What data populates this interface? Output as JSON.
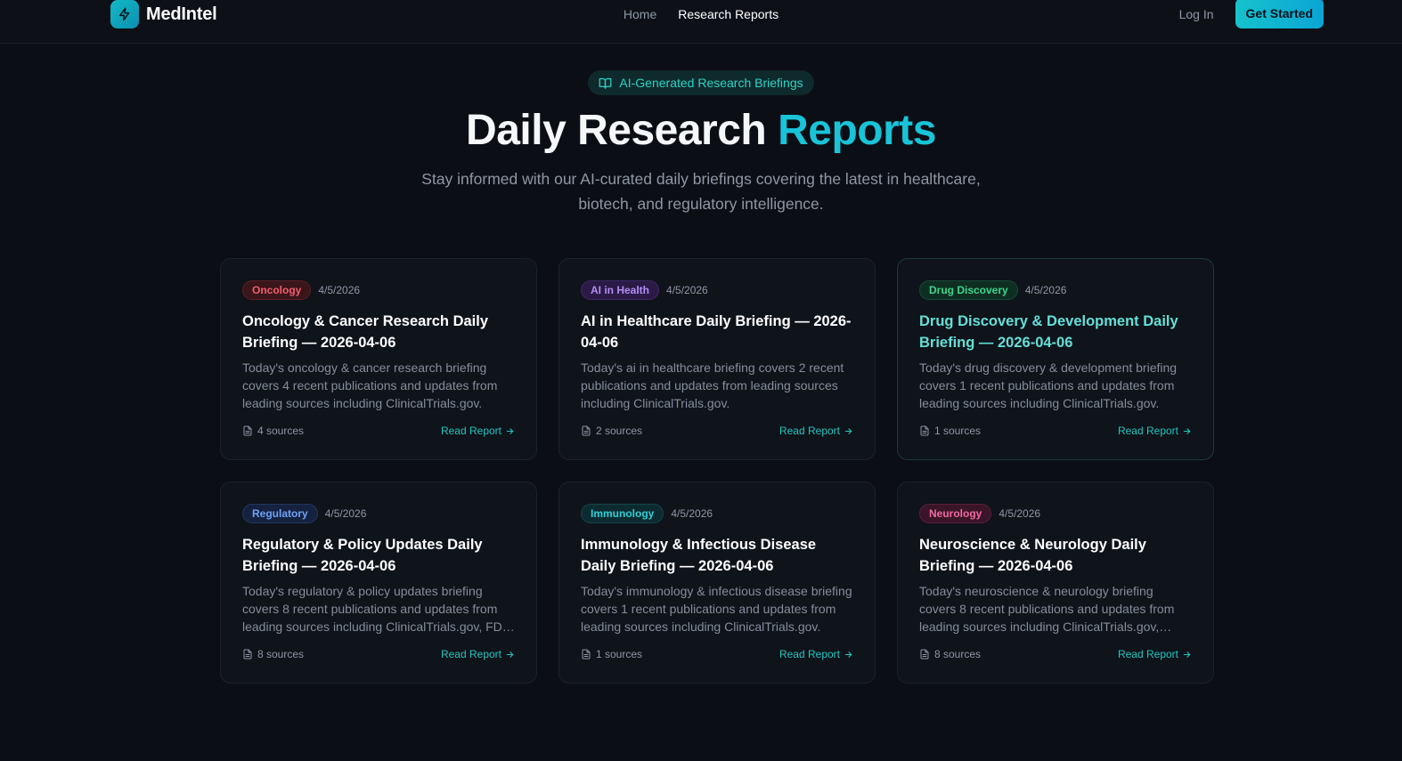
{
  "nav": {
    "brand": "MedIntel",
    "links": [
      "Home",
      "Research Reports"
    ],
    "login": "Log In",
    "cta": "Get Started"
  },
  "hero": {
    "badge": "AI-Generated Research Briefings",
    "title_main": "Daily Research",
    "title_accent": "Reports",
    "subtitle": "Stay informed with our AI-curated daily briefings covering the latest in healthcare, biotech, and regulatory intelligence."
  },
  "cards": [
    {
      "tag": "Oncology",
      "tag_color": "#f0606e",
      "tag_bg": "#3a1519",
      "tag_border": "#5a2027",
      "date": "4/5/2026",
      "title": "Oncology & Cancer Research Daily Briefing — 2026-04-06",
      "desc": "Today's oncology & cancer research briefing covers 4 recent publications and updates from leading sources including ClinicalTrials.gov.",
      "sources": "4 sources",
      "read": "Read Report"
    },
    {
      "tag": "AI in Health",
      "tag_color": "#b48cf6",
      "tag_bg": "#2a1a45",
      "tag_border": "#3d2866",
      "date": "4/5/2026",
      "title": "AI in Healthcare Daily Briefing — 2026-04-06",
      "desc": "Today's ai in healthcare briefing covers 2 recent publications and updates from leading sources including ClinicalTrials.gov.",
      "sources": "2 sources",
      "read": "Read Report"
    },
    {
      "tag": "Drug Discovery",
      "tag_color": "#3dd68c",
      "tag_bg": "#0f2e22",
      "tag_border": "#17493a",
      "date": "4/5/2026",
      "title": "Drug Discovery & Development Daily Briefing — 2026-04-06",
      "desc": "Today's drug discovery & development briefing covers 1 recent publications and updates from leading sources including ClinicalTrials.gov.",
      "sources": "1 sources",
      "read": "Read Report"
    },
    {
      "tag": "Regulatory",
      "tag_color": "#6ea2f7",
      "tag_bg": "#15223f",
      "tag_border": "#22375f",
      "date": "4/5/2026",
      "title": "Regulatory & Policy Updates Daily Briefing — 2026-04-06",
      "desc": "Today's regulatory & policy updates briefing covers 8 recent publications and updates from leading sources including ClinicalTrials.gov, FDA and more.",
      "sources": "8 sources",
      "read": "Read Report"
    },
    {
      "tag": "Immunology",
      "tag_color": "#2ed0d6",
      "tag_bg": "#0c2b30",
      "tag_border": "#154449",
      "date": "4/5/2026",
      "title": "Immunology & Infectious Disease Daily Briefing — 2026-04-06",
      "desc": "Today's immunology & infectious disease briefing covers 1 recent publications and updates from leading sources including ClinicalTrials.gov.",
      "sources": "1 sources",
      "read": "Read Report"
    },
    {
      "tag": "Neurology",
      "tag_color": "#f06aa4",
      "tag_bg": "#3a1427",
      "tag_border": "#5a2039",
      "date": "4/5/2026",
      "title": "Neuroscience & Neurology Daily Briefing — 2026-04-06",
      "desc": "Today's neuroscience & neurology briefing covers 8 recent publications and updates from leading sources including ClinicalTrials.gov, PubMed and more.",
      "sources": "8 sources",
      "read": "Read Report"
    }
  ]
}
